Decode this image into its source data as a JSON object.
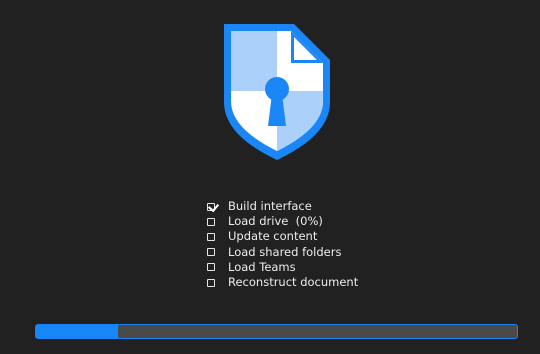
{
  "logo": {
    "icon": "shield-keyhole-icon",
    "colors": {
      "outline": "#1b86f5",
      "light_panel": "#abd0fa",
      "white_panel": "#ffffff",
      "keyhole": "#1b86f5"
    }
  },
  "steps": [
    {
      "label": "Build interface",
      "checked": true
    },
    {
      "label": "Load drive  (0%)",
      "checked": false
    },
    {
      "label": "Update content",
      "checked": false
    },
    {
      "label": "Load shared folders",
      "checked": false
    },
    {
      "label": "Load Teams",
      "checked": false
    },
    {
      "label": "Reconstruct document",
      "checked": false
    }
  ],
  "progress": {
    "value": 0.17,
    "fill_color": "#1786f6",
    "track_color": "#4a4a4a"
  }
}
